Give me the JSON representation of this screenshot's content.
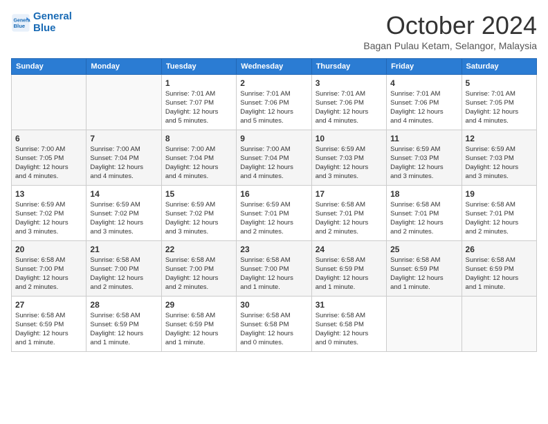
{
  "header": {
    "logo_line1": "General",
    "logo_line2": "Blue",
    "month": "October 2024",
    "location": "Bagan Pulau Ketam, Selangor, Malaysia"
  },
  "days_of_week": [
    "Sunday",
    "Monday",
    "Tuesday",
    "Wednesday",
    "Thursday",
    "Friday",
    "Saturday"
  ],
  "weeks": [
    [
      {
        "day": "",
        "info": ""
      },
      {
        "day": "",
        "info": ""
      },
      {
        "day": "1",
        "info": "Sunrise: 7:01 AM\nSunset: 7:07 PM\nDaylight: 12 hours\nand 5 minutes."
      },
      {
        "day": "2",
        "info": "Sunrise: 7:01 AM\nSunset: 7:06 PM\nDaylight: 12 hours\nand 5 minutes."
      },
      {
        "day": "3",
        "info": "Sunrise: 7:01 AM\nSunset: 7:06 PM\nDaylight: 12 hours\nand 4 minutes."
      },
      {
        "day": "4",
        "info": "Sunrise: 7:01 AM\nSunset: 7:06 PM\nDaylight: 12 hours\nand 4 minutes."
      },
      {
        "day": "5",
        "info": "Sunrise: 7:01 AM\nSunset: 7:05 PM\nDaylight: 12 hours\nand 4 minutes."
      }
    ],
    [
      {
        "day": "6",
        "info": "Sunrise: 7:00 AM\nSunset: 7:05 PM\nDaylight: 12 hours\nand 4 minutes."
      },
      {
        "day": "7",
        "info": "Sunrise: 7:00 AM\nSunset: 7:04 PM\nDaylight: 12 hours\nand 4 minutes."
      },
      {
        "day": "8",
        "info": "Sunrise: 7:00 AM\nSunset: 7:04 PM\nDaylight: 12 hours\nand 4 minutes."
      },
      {
        "day": "9",
        "info": "Sunrise: 7:00 AM\nSunset: 7:04 PM\nDaylight: 12 hours\nand 4 minutes."
      },
      {
        "day": "10",
        "info": "Sunrise: 6:59 AM\nSunset: 7:03 PM\nDaylight: 12 hours\nand 3 minutes."
      },
      {
        "day": "11",
        "info": "Sunrise: 6:59 AM\nSunset: 7:03 PM\nDaylight: 12 hours\nand 3 minutes."
      },
      {
        "day": "12",
        "info": "Sunrise: 6:59 AM\nSunset: 7:03 PM\nDaylight: 12 hours\nand 3 minutes."
      }
    ],
    [
      {
        "day": "13",
        "info": "Sunrise: 6:59 AM\nSunset: 7:02 PM\nDaylight: 12 hours\nand 3 minutes."
      },
      {
        "day": "14",
        "info": "Sunrise: 6:59 AM\nSunset: 7:02 PM\nDaylight: 12 hours\nand 3 minutes."
      },
      {
        "day": "15",
        "info": "Sunrise: 6:59 AM\nSunset: 7:02 PM\nDaylight: 12 hours\nand 3 minutes."
      },
      {
        "day": "16",
        "info": "Sunrise: 6:59 AM\nSunset: 7:01 PM\nDaylight: 12 hours\nand 2 minutes."
      },
      {
        "day": "17",
        "info": "Sunrise: 6:58 AM\nSunset: 7:01 PM\nDaylight: 12 hours\nand 2 minutes."
      },
      {
        "day": "18",
        "info": "Sunrise: 6:58 AM\nSunset: 7:01 PM\nDaylight: 12 hours\nand 2 minutes."
      },
      {
        "day": "19",
        "info": "Sunrise: 6:58 AM\nSunset: 7:01 PM\nDaylight: 12 hours\nand 2 minutes."
      }
    ],
    [
      {
        "day": "20",
        "info": "Sunrise: 6:58 AM\nSunset: 7:00 PM\nDaylight: 12 hours\nand 2 minutes."
      },
      {
        "day": "21",
        "info": "Sunrise: 6:58 AM\nSunset: 7:00 PM\nDaylight: 12 hours\nand 2 minutes."
      },
      {
        "day": "22",
        "info": "Sunrise: 6:58 AM\nSunset: 7:00 PM\nDaylight: 12 hours\nand 2 minutes."
      },
      {
        "day": "23",
        "info": "Sunrise: 6:58 AM\nSunset: 7:00 PM\nDaylight: 12 hours\nand 1 minute."
      },
      {
        "day": "24",
        "info": "Sunrise: 6:58 AM\nSunset: 6:59 PM\nDaylight: 12 hours\nand 1 minute."
      },
      {
        "day": "25",
        "info": "Sunrise: 6:58 AM\nSunset: 6:59 PM\nDaylight: 12 hours\nand 1 minute."
      },
      {
        "day": "26",
        "info": "Sunrise: 6:58 AM\nSunset: 6:59 PM\nDaylight: 12 hours\nand 1 minute."
      }
    ],
    [
      {
        "day": "27",
        "info": "Sunrise: 6:58 AM\nSunset: 6:59 PM\nDaylight: 12 hours\nand 1 minute."
      },
      {
        "day": "28",
        "info": "Sunrise: 6:58 AM\nSunset: 6:59 PM\nDaylight: 12 hours\nand 1 minute."
      },
      {
        "day": "29",
        "info": "Sunrise: 6:58 AM\nSunset: 6:59 PM\nDaylight: 12 hours\nand 1 minute."
      },
      {
        "day": "30",
        "info": "Sunrise: 6:58 AM\nSunset: 6:58 PM\nDaylight: 12 hours\nand 0 minutes."
      },
      {
        "day": "31",
        "info": "Sunrise: 6:58 AM\nSunset: 6:58 PM\nDaylight: 12 hours\nand 0 minutes."
      },
      {
        "day": "",
        "info": ""
      },
      {
        "day": "",
        "info": ""
      }
    ]
  ]
}
